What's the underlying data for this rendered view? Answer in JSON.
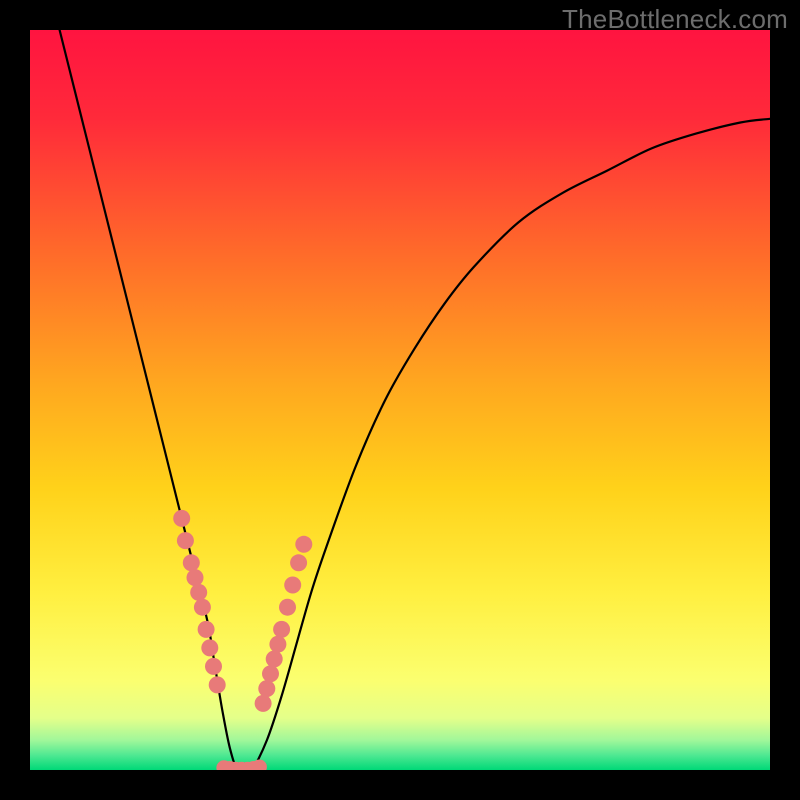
{
  "watermark": "TheBottleneck.com",
  "colors": {
    "background": "#000000",
    "gradient_top": "#ff1a3f",
    "gradient_mid": "#ffc800",
    "gradient_low": "#ffff66",
    "gradient_bottom": "#00e676",
    "curve": "#000000",
    "dots": "#e87a79",
    "watermark": "#6d6d6d"
  },
  "chart_data": {
    "type": "line",
    "title": "",
    "xlabel": "",
    "ylabel": "",
    "xlim": [
      0,
      100
    ],
    "ylim": [
      0,
      100
    ],
    "series": [
      {
        "name": "bottleneck-curve",
        "x": [
          4,
          6,
          8,
          10,
          12,
          14,
          16,
          18,
          20,
          22,
          24,
          25,
          26,
          27,
          28,
          29,
          30,
          32,
          34,
          36,
          38,
          40,
          44,
          48,
          52,
          56,
          60,
          66,
          72,
          78,
          84,
          90,
          96,
          100
        ],
        "y": [
          100,
          92,
          84,
          76,
          68,
          60,
          52,
          44,
          36,
          28,
          20,
          14,
          8,
          3,
          0,
          0,
          0,
          4,
          10,
          17,
          24,
          30,
          41,
          50,
          57,
          63,
          68,
          74,
          78,
          81,
          84,
          86,
          87.5,
          88
        ]
      }
    ],
    "dot_clusters": [
      {
        "name": "left-branch-dots",
        "points": [
          {
            "x": 20.5,
            "y": 34
          },
          {
            "x": 21.0,
            "y": 31
          },
          {
            "x": 21.8,
            "y": 28
          },
          {
            "x": 22.3,
            "y": 26
          },
          {
            "x": 22.8,
            "y": 24
          },
          {
            "x": 23.3,
            "y": 22
          },
          {
            "x": 23.8,
            "y": 19
          },
          {
            "x": 24.3,
            "y": 16.5
          },
          {
            "x": 24.8,
            "y": 14
          },
          {
            "x": 25.3,
            "y": 11.5
          }
        ]
      },
      {
        "name": "right-branch-dots",
        "points": [
          {
            "x": 31.5,
            "y": 9
          },
          {
            "x": 32.0,
            "y": 11
          },
          {
            "x": 32.5,
            "y": 13
          },
          {
            "x": 33.0,
            "y": 15
          },
          {
            "x": 33.5,
            "y": 17
          },
          {
            "x": 34.0,
            "y": 19
          },
          {
            "x": 34.8,
            "y": 22
          },
          {
            "x": 35.5,
            "y": 25
          },
          {
            "x": 36.3,
            "y": 28
          },
          {
            "x": 37.0,
            "y": 30.5
          }
        ]
      },
      {
        "name": "valley-dots",
        "points": [
          {
            "x": 26.2,
            "y": 0.3
          },
          {
            "x": 27.0,
            "y": 0.2
          },
          {
            "x": 27.8,
            "y": 0.1
          },
          {
            "x": 28.6,
            "y": 0.1
          },
          {
            "x": 29.4,
            "y": 0.1
          },
          {
            "x": 30.2,
            "y": 0.2
          },
          {
            "x": 31.0,
            "y": 0.4
          }
        ]
      }
    ]
  }
}
